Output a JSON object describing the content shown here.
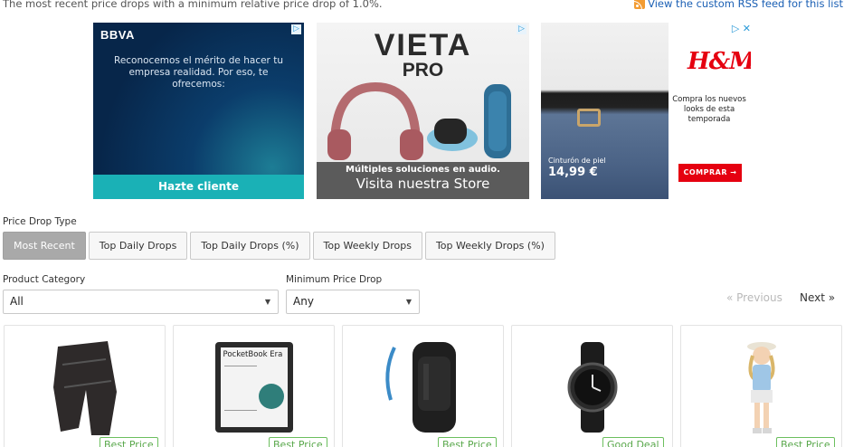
{
  "header": {
    "intro_text": "The most recent price drops with a minimum relative price drop of 1.0%.",
    "rss_link": "View the custom RSS feed for this list"
  },
  "ads": {
    "bbva": {
      "logo": "BBVA",
      "text": "Reconocemos el mérito de hacer tu empresa realidad. Por eso, te ofrecemos:",
      "cta": "Hazte cliente"
    },
    "vieta": {
      "logo": "VIETA",
      "logo_sub": "PRO",
      "line1": "Múltiples soluciones en audio.",
      "line2": "Visita nuestra Store"
    },
    "hm": {
      "logo": "H&M",
      "text": "Compra los nuevos looks de esta temporada",
      "price_label": "Cinturón de piel",
      "price": "14,99 €",
      "cta": "COMPRAR →"
    }
  },
  "filters": {
    "price_drop_type_label": "Price Drop Type",
    "tabs": [
      {
        "label": "Most Recent",
        "active": true
      },
      {
        "label": "Top Daily Drops",
        "active": false
      },
      {
        "label": "Top Daily Drops (%)",
        "active": false
      },
      {
        "label": "Top Weekly Drops",
        "active": false
      },
      {
        "label": "Top Weekly Drops (%)",
        "active": false
      }
    ],
    "product_category_label": "Product Category",
    "product_category_value": "All",
    "min_price_drop_label": "Minimum Price Drop",
    "min_price_drop_value": "Any"
  },
  "pagination": {
    "previous": "« Previous",
    "next": "Next »"
  },
  "products": [
    {
      "image": "padded-shorts-image",
      "badge": "Best Price"
    },
    {
      "image": "pocketbook-era-ereader-image",
      "image_text": "PocketBook Era",
      "badge": "Best Price"
    },
    {
      "image": "hydration-backpack-image",
      "badge": "Best Price"
    },
    {
      "image": "smartwatch-image",
      "badge": "Good Deal"
    },
    {
      "image": "doll-image",
      "badge": "Best Price"
    }
  ],
  "colors": {
    "badge_green": "#5aa84c",
    "active_tab": "#a9a9a9",
    "link_blue": "#1a5fb4",
    "hm_red": "#e50010",
    "bbva_teal": "#1ab1b6"
  }
}
